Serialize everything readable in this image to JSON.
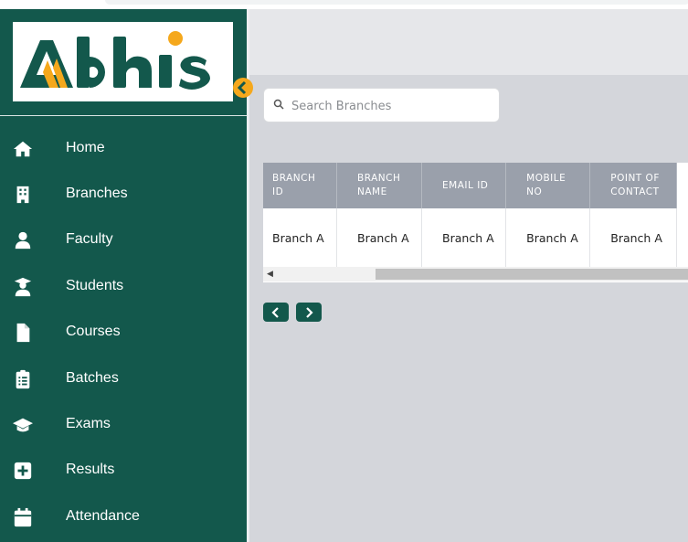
{
  "app": {
    "logo_text": "Abhis"
  },
  "sidebar": {
    "items": [
      {
        "label": "Home",
        "icon": "home-icon"
      },
      {
        "label": "Branches",
        "icon": "building-icon"
      },
      {
        "label": "Faculty",
        "icon": "user-icon"
      },
      {
        "label": "Students",
        "icon": "graduate-user-icon"
      },
      {
        "label": "Courses",
        "icon": "file-icon"
      },
      {
        "label": "Batches",
        "icon": "clipboard-list-icon"
      },
      {
        "label": "Exams",
        "icon": "graduation-cap-icon"
      },
      {
        "label": "Results",
        "icon": "plus-square-icon"
      },
      {
        "label": "Attendance",
        "icon": "calendar-icon"
      }
    ]
  },
  "search": {
    "placeholder": "Search Branches",
    "value": ""
  },
  "table": {
    "headers": [
      "BRANCH ID",
      "BRANCH NAME",
      "EMAIL ID",
      "MOBILE NO",
      "POINT OF CONTACT"
    ],
    "header_lines": [
      [
        "BRANCH",
        "ID"
      ],
      [
        "BRANCH",
        "NAME"
      ],
      [
        "EMAIL ID"
      ],
      [
        "MOBILE",
        "NO"
      ],
      [
        "POINT OF",
        "CONTACT"
      ]
    ],
    "rows": [
      [
        "Branch A",
        "Branch A",
        "Branch A",
        "Branch A",
        "Branch A"
      ]
    ]
  },
  "pagination": {
    "prev_icon": "chevron-left-icon",
    "next_icon": "chevron-right-icon"
  },
  "colors": {
    "sidebar": "#13584c",
    "accent": "#f5a81c",
    "header": "#9aa0ab"
  }
}
